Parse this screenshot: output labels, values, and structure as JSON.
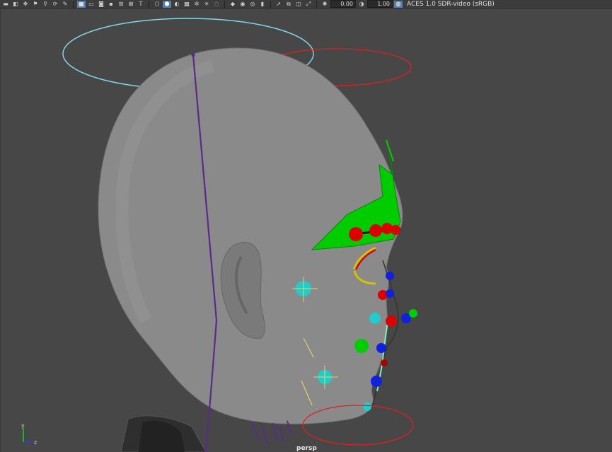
{
  "toolbar": {
    "icons_left": [
      "camera-icon",
      "camera-select-icon",
      "camera-move-icon",
      "bookmark-icon",
      "snap-icon",
      "pivot-icon",
      "pencil-icon"
    ],
    "icons_display": [
      "grid-icon",
      "film-gate-icon",
      "resolution-gate-icon",
      "gate-mask-icon",
      "field-chart-icon",
      "safe-action-icon",
      "safe-title-icon"
    ],
    "icons_shading": [
      "wireframe-icon",
      "smooth-shade-icon",
      "wire-on-shaded-icon",
      "textured-icon",
      "lights-icon",
      "shadows-icon",
      "ambient-occlusion-icon"
    ],
    "icons_misc": [
      "isolate-icon",
      "xray-icon",
      "xray-joints-icon",
      "backface-icon",
      "select-icon",
      "component-icon",
      "texture-cam-icon",
      "scale-icon"
    ],
    "exposure_value": "0.00",
    "gamma_value": "1.00",
    "color_space": "ACES 1.0 SDR-video (sRGB)"
  },
  "viewport": {
    "camera": "persp",
    "axis_labels": {
      "y": "y",
      "z": "z"
    }
  },
  "colors": {
    "viewport_bg": "#474747",
    "mesh": "#8a8a8a",
    "control_green": "#00cc00",
    "control_red": "#dd0000",
    "control_blue": "#1020dd",
    "control_cyan": "#22cccc",
    "halo_cyan": "#7fd6e8",
    "halo_red": "#e02020",
    "joint_purple": "#5a2a8a"
  }
}
